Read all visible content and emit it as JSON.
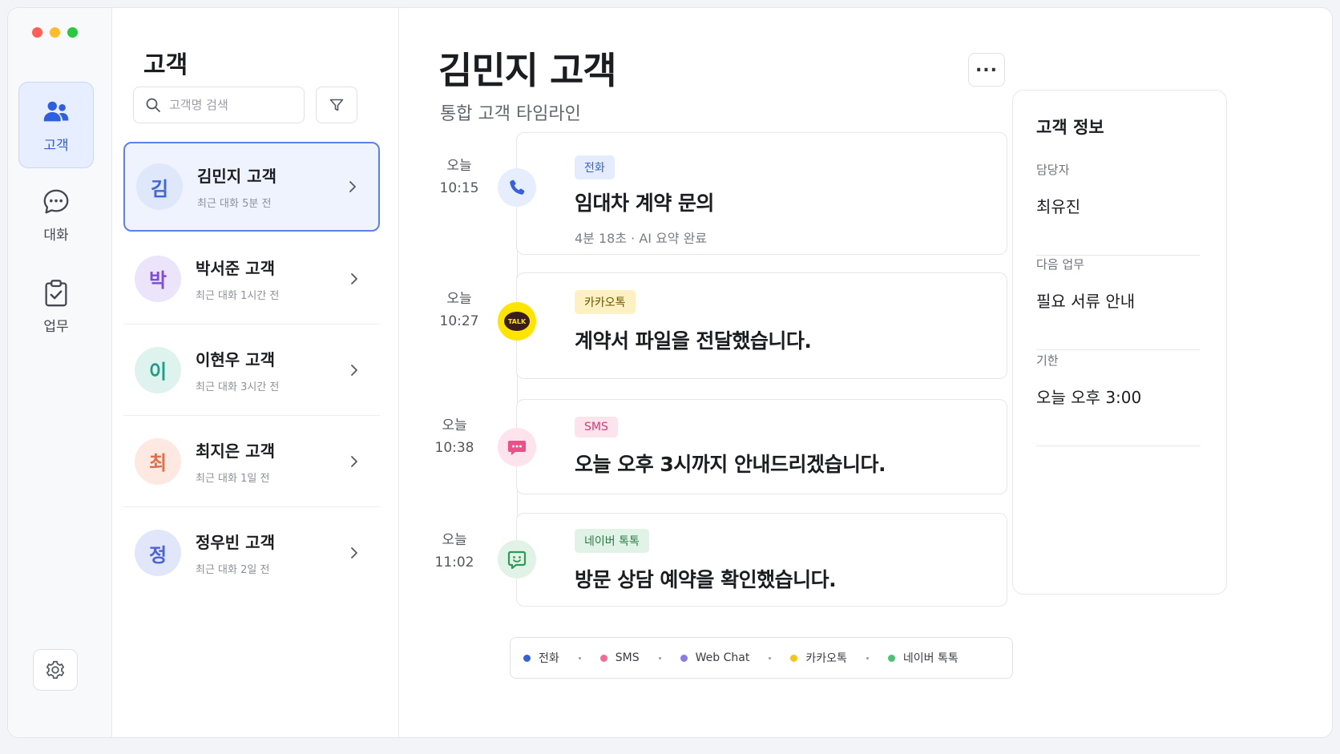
{
  "window": {
    "traffic_colors": [
      "#ff5f57",
      "#febc2e",
      "#28c840"
    ]
  },
  "rail": {
    "items": [
      {
        "label": "고객",
        "icon": "users-icon",
        "active": true
      },
      {
        "label": "대화",
        "icon": "chat-bubble-icon",
        "active": false
      },
      {
        "label": "업무",
        "icon": "clipboard-check-icon",
        "active": false
      }
    ],
    "settings_icon": "gear-icon"
  },
  "list": {
    "title": "고객",
    "search_placeholder": "고객명 검색",
    "filter_icon": "filter-icon",
    "customers": [
      {
        "initial": "김",
        "name": "김민지 고객",
        "sub": "최근 대화 5분 전",
        "color": "#3f66d9",
        "bg": "#dfe7fb",
        "selected": true
      },
      {
        "initial": "박",
        "name": "박서준 고객",
        "sub": "최근 대화 1시간 전",
        "color": "#7c4dd6",
        "bg": "#ece4fb",
        "selected": false
      },
      {
        "initial": "이",
        "name": "이현우 고객",
        "sub": "최근 대화 3시간 전",
        "color": "#1f9c86",
        "bg": "#dff3ee",
        "selected": false
      },
      {
        "initial": "최",
        "name": "최지은 고객",
        "sub": "최근 대화 1일 전",
        "color": "#e0704a",
        "bg": "#fde9e1",
        "selected": false
      },
      {
        "initial": "정",
        "name": "정우빈 고객",
        "sub": "최근 대화 2일 전",
        "color": "#4a64d8",
        "bg": "#e2e6fa",
        "selected": false
      }
    ]
  },
  "main": {
    "title": "김민지 고객",
    "subtitle": "통합 고객 타임라인",
    "more_label": "...",
    "timeline": [
      {
        "day": "오늘",
        "time": "10:15",
        "channel": "전화",
        "icon": "phone-icon",
        "title": "임대차 계약 문의",
        "meta": "4분 18초 · AI 요약 완료"
      },
      {
        "day": "오늘",
        "time": "10:27",
        "channel": "카카오톡",
        "icon": "kakaotalk-icon",
        "icon_text": "TALK",
        "title": "계약서 파일을 전달했습니다.",
        "meta": ""
      },
      {
        "day": "오늘",
        "time": "10:38",
        "channel": "SMS",
        "icon": "sms-icon",
        "title": "오늘 오후 3시까지 안내드리겠습니다.",
        "meta": ""
      },
      {
        "day": "오늘",
        "time": "11:02",
        "channel": "네이버 톡톡",
        "icon": "naver-talk-icon",
        "title": "방문 상담 예약을 확인했습니다.",
        "meta": ""
      }
    ],
    "legend": [
      {
        "label": "전화",
        "color": "#3560e0"
      },
      {
        "label": "SMS",
        "color": "#f06b9a"
      },
      {
        "label": "Web Chat",
        "color": "#8d7be3"
      },
      {
        "label": "카카오톡",
        "color": "#f5c518"
      },
      {
        "label": "네이버 톡톡",
        "color": "#4fc074"
      }
    ]
  },
  "info": {
    "title": "고객 정보",
    "fields": [
      {
        "label": "담당자",
        "value": "최유진"
      },
      {
        "label": "다음 업무",
        "value": "필요 서류 안내"
      },
      {
        "label": "기한",
        "value": "오늘 오후 3:00"
      }
    ]
  }
}
